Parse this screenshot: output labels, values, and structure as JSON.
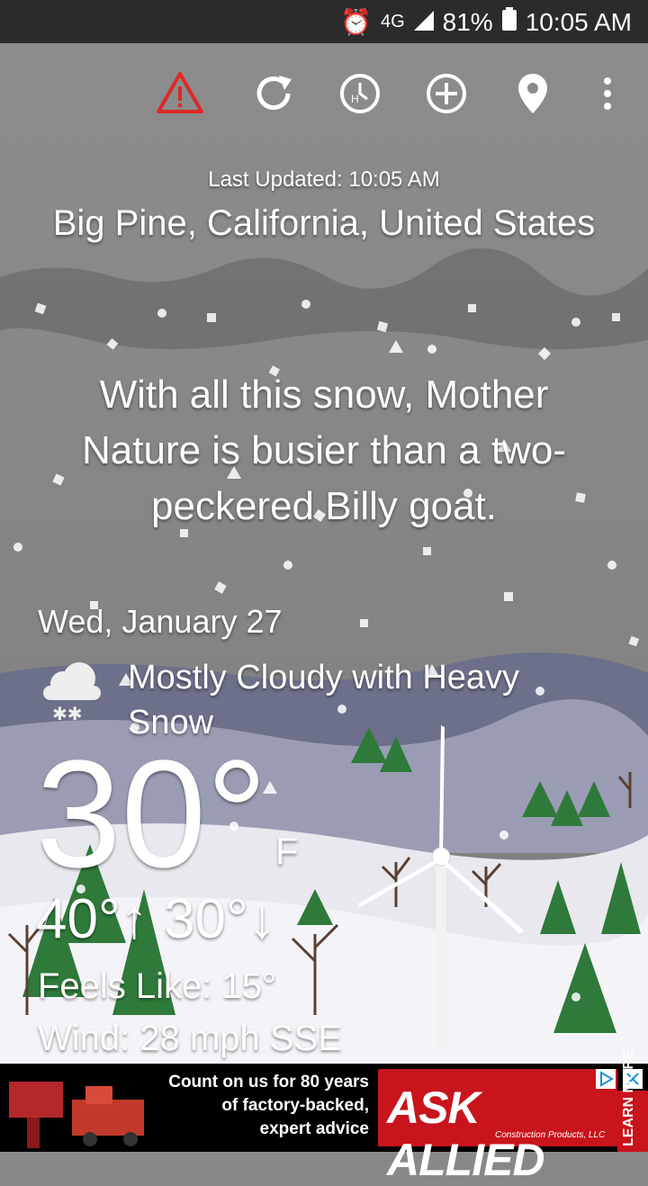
{
  "status_bar": {
    "network": "4G",
    "battery": "81%",
    "time": "10:05 AM"
  },
  "toolbar": {
    "icons": [
      "alert-icon",
      "refresh-icon",
      "history-icon",
      "add-icon",
      "location-icon",
      "more-icon"
    ]
  },
  "weather": {
    "last_updated": "Last Updated: 10:05 AM",
    "location": "Big Pine, California, United States",
    "quote": "With all this snow, Mother Nature is busier than a two-peckered Billy goat.",
    "date": "Wed, January 27",
    "condition": "Mostly Cloudy with Heavy Snow",
    "temperature": "30°",
    "unit": "F",
    "high_low": "40°↑ 30°↓",
    "feels_like": "Feels Like: 15°",
    "wind": "Wind: 28 mph SSE"
  },
  "ad": {
    "line1": "Count on us for 80 years",
    "line2": "of factory-backed,",
    "line3": "expert advice",
    "brand": "ASK ALLIED",
    "brand_sub": "Construction Products, LLC",
    "more": "LEARN MORE"
  },
  "colors": {
    "status_bar": "#2b2b2b",
    "sky": "#8a8a8a",
    "mountains": "#6b6f86",
    "snow": "#f0f0f4",
    "alert": "#e02828",
    "ad_red": "#c9141c"
  }
}
